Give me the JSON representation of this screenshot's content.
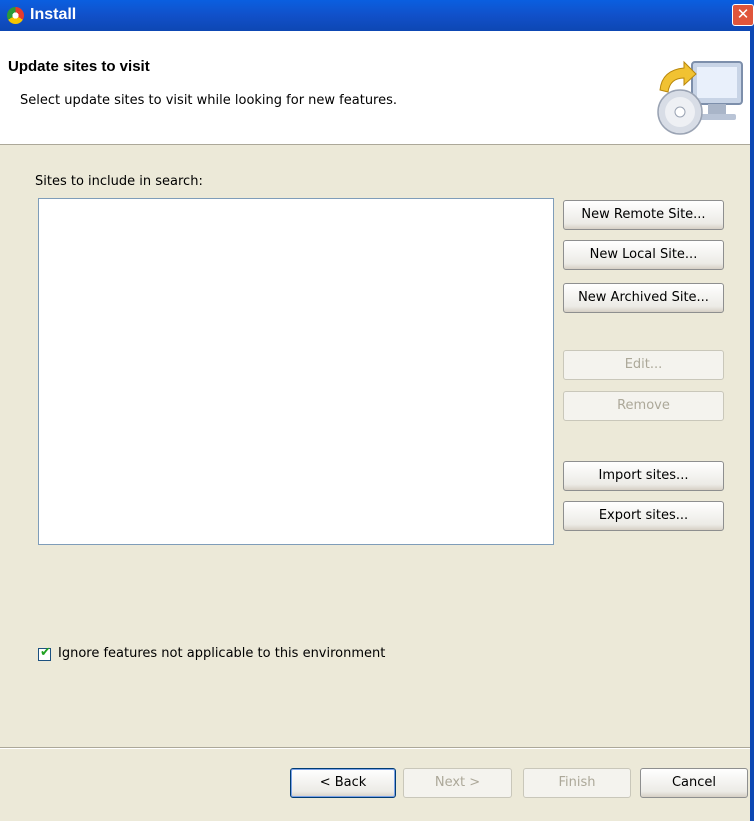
{
  "window": {
    "title": "Install",
    "close_glyph": "✕"
  },
  "header": {
    "title": "Update sites to visit",
    "description": "Select update sites to visit while looking for new features."
  },
  "sites": {
    "label": "Sites to include in search:",
    "items": []
  },
  "side_buttons": {
    "new_remote": "New Remote Site...",
    "new_local": "New Local Site...",
    "new_archived": "New Archived Site...",
    "edit": "Edit...",
    "remove": "Remove",
    "import": "Import sites...",
    "export": "Export sites..."
  },
  "checkbox": {
    "label": "Ignore features not applicable to this environment",
    "checked": true,
    "mark": "✔"
  },
  "footer": {
    "back": "< Back",
    "next": "Next >",
    "finish": "Finish",
    "cancel": "Cancel"
  },
  "icons": {
    "app": "eclipse-icon",
    "wizard": "install-wizard-icon"
  }
}
